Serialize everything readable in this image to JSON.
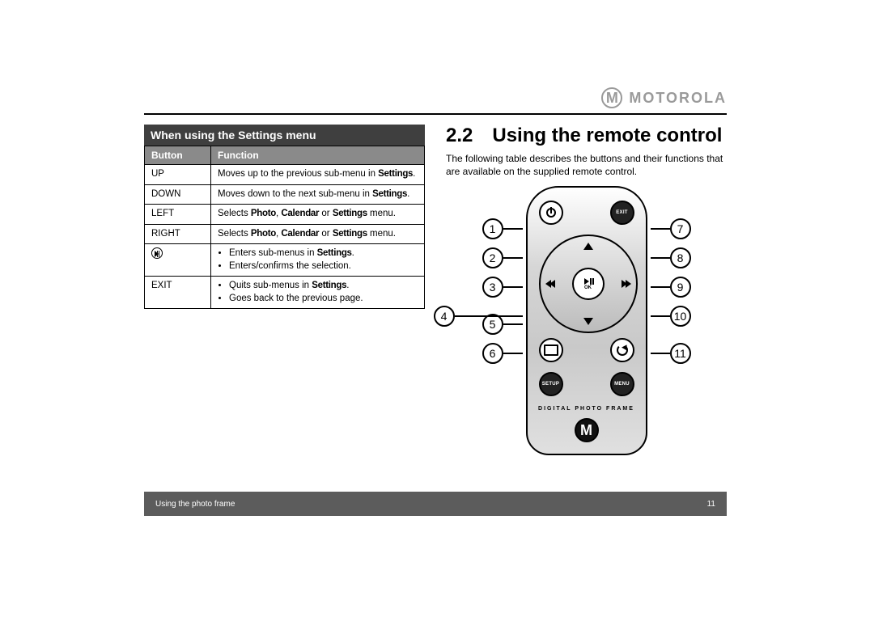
{
  "brand": {
    "name": "MOTOROLA",
    "logo_letter": "M"
  },
  "left": {
    "title": "When using the Settings menu",
    "headers": {
      "button": "Button",
      "function": "Function"
    },
    "rows": [
      {
        "button": "UP",
        "func_prefix": "Moves up to the previous sub-menu in ",
        "func_strong": "Settings",
        "func_suffix": "."
      },
      {
        "button": "DOWN",
        "func_prefix": "Moves down to the next sub-menu in ",
        "func_strong": "Settings",
        "func_suffix": "."
      },
      {
        "button": "LEFT",
        "func_prefix": "Selects ",
        "func_strong_multi": [
          "Photo",
          "Calendar",
          "Settings"
        ],
        "joiners": [
          ", ",
          " or "
        ],
        "func_suffix": " menu."
      },
      {
        "button": "RIGHT",
        "func_prefix": "Selects ",
        "func_strong_multi": [
          "Photo",
          "Calendar",
          "Settings"
        ],
        "joiners": [
          ", ",
          " or "
        ],
        "func_suffix": " menu."
      },
      {
        "button_icon": "play-pause",
        "bullets": [
          {
            "prefix": "Enters sub-menus in ",
            "strong": "Settings",
            "suffix": "."
          },
          {
            "text": "Enters/confirms the selection."
          }
        ]
      },
      {
        "button": "EXIT",
        "bullets": [
          {
            "prefix": "Quits sub-menus in ",
            "strong": "Settings",
            "suffix": "."
          },
          {
            "text": "Goes back to the previous page."
          }
        ]
      }
    ]
  },
  "right": {
    "section_number": "2.2",
    "section_title": "Using the remote control",
    "paragraph": "The following table describes the buttons and their functions that are available on the supplied remote control.",
    "remote": {
      "top_left_btn": "power",
      "top_right_btn_label": "EXIT",
      "bottom_left_btn_label": "SETUP",
      "bottom_right_btn_label": "MENU",
      "ok_label": "OK",
      "device_label": "DIGITAL  PHOTO  FRAME",
      "logo_letter": "M"
    },
    "callouts": {
      "left": [
        "1",
        "2",
        "3",
        "4",
        "5",
        "6"
      ],
      "right": [
        "7",
        "8",
        "9",
        "10",
        "11"
      ]
    }
  },
  "footer": {
    "left": "Using the photo frame",
    "page": "11"
  }
}
